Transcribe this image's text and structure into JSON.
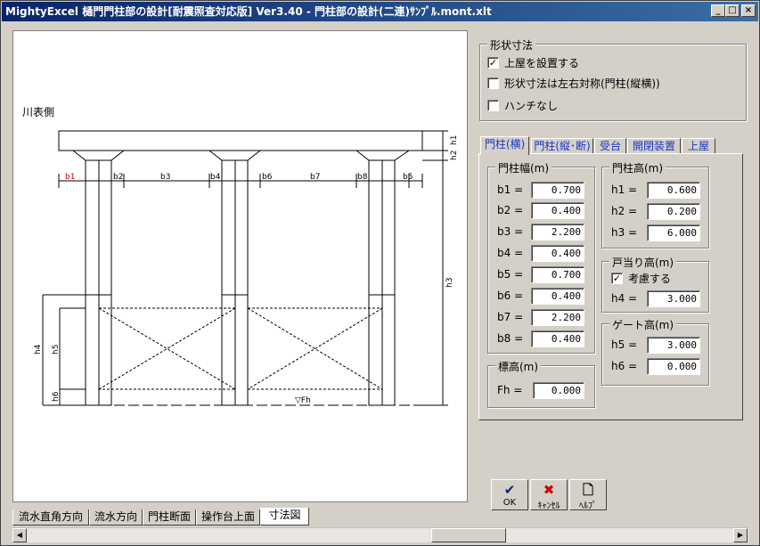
{
  "window": {
    "title": "MightyExcel 樋門門柱部の設計[耐震照査対応版] Ver3.40 - 門柱部の設計(二連)ｻﾝﾌﾟﾙ.mont.xlt",
    "minimize": "_",
    "maximize": "□",
    "close": "×"
  },
  "drawing": {
    "side_label": "川表側",
    "dims": {
      "b1": "b1",
      "b2": "b2",
      "b3": "b3",
      "b4": "b4",
      "b5": "b5",
      "b6": "b6",
      "b7": "b7",
      "b8": "b8",
      "h1": "h1",
      "h2": "h2",
      "h3": "h3",
      "h4": "h4",
      "h5": "h5",
      "h6": "h6",
      "fh": "▽Fh"
    }
  },
  "shape": {
    "title": "形状寸法",
    "checks": [
      {
        "label": "上屋を設置する",
        "checked": true
      },
      {
        "label": "形状寸法は左右対称(門柱(縦横))",
        "checked": false
      },
      {
        "label": "ハンチなし",
        "checked": false
      }
    ]
  },
  "tabs": [
    {
      "label": "門柱(横)",
      "active": true
    },
    {
      "label": "門柱(縦･断)",
      "active": false
    },
    {
      "label": "受台",
      "active": false
    },
    {
      "label": "開閉装置",
      "active": false
    },
    {
      "label": "上屋",
      "active": false
    }
  ],
  "width_group": {
    "title": "門柱幅(m)",
    "rows": [
      {
        "label": "b1 =",
        "value": "0.700"
      },
      {
        "label": "b2 =",
        "value": "0.400"
      },
      {
        "label": "b3 =",
        "value": "2.200"
      },
      {
        "label": "b4 =",
        "value": "0.400"
      },
      {
        "label": "b5 =",
        "value": "0.700"
      },
      {
        "label": "b6 =",
        "value": "0.400"
      },
      {
        "label": "b7 =",
        "value": "2.200"
      },
      {
        "label": "b8 =",
        "value": "0.400"
      }
    ]
  },
  "height_group": {
    "title": "門柱高(m)",
    "rows": [
      {
        "label": "h1 =",
        "value": "0.600"
      },
      {
        "label": "h2 =",
        "value": "0.200"
      },
      {
        "label": "h3 =",
        "value": "6.000"
      }
    ]
  },
  "stop_group": {
    "title": "戸当り高(m)",
    "check_label": "考慮する",
    "checked": true,
    "row": {
      "label": "h4 =",
      "value": "3.000"
    }
  },
  "gate_group": {
    "title": "ゲート高(m)",
    "rows": [
      {
        "label": "h5 =",
        "value": "3.000"
      },
      {
        "label": "h6 =",
        "value": "0.000"
      }
    ]
  },
  "elev_group": {
    "title": "標高(m)",
    "row": {
      "label": "Fh =",
      "value": "0.000"
    }
  },
  "buttons": [
    {
      "label": "OK",
      "icon": "check-icon"
    },
    {
      "label": "ｷｬﾝｾﾙ",
      "icon": "cross-icon"
    },
    {
      "label": "ﾍﾙﾌﾟ",
      "icon": "document-icon"
    }
  ],
  "sheet_tabs": [
    {
      "label": "流水直角方向",
      "active": false
    },
    {
      "label": "流水方向",
      "active": false
    },
    {
      "label": "門柱断面",
      "active": false
    },
    {
      "label": "操作台上面",
      "active": false
    },
    {
      "label": "寸法図",
      "active": true
    }
  ],
  "colors": {
    "tab_text": "#1a35c8",
    "b1_dim": "#cc0000",
    "ok_icon": "#0a246a",
    "cancel_icon": "#cc0000"
  }
}
